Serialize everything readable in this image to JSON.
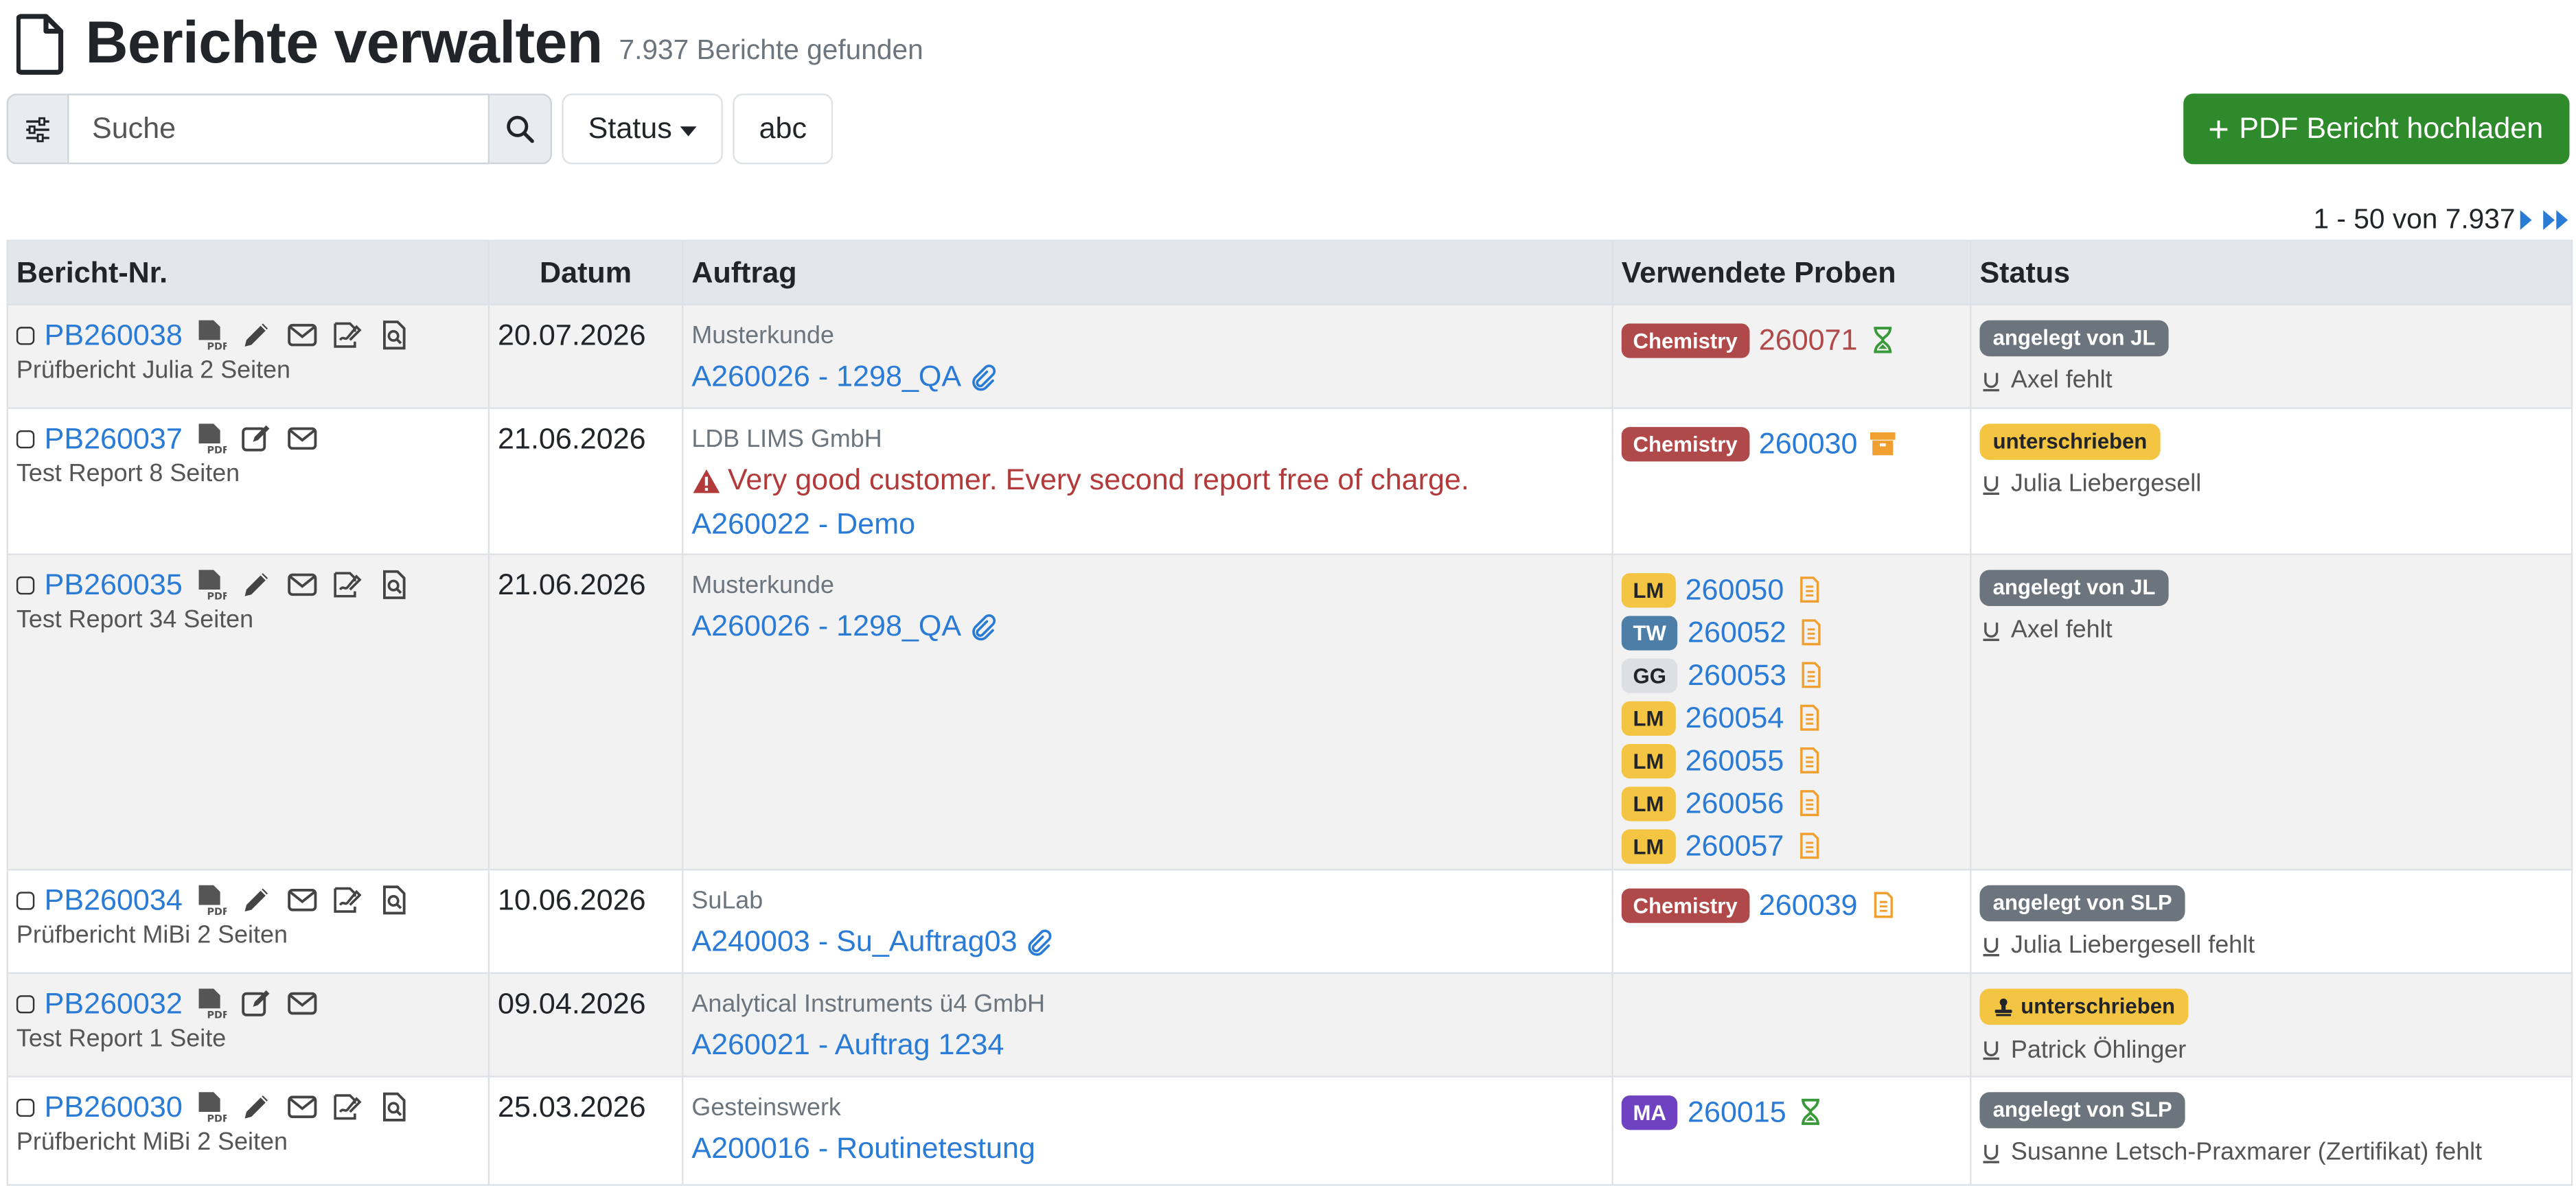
{
  "header": {
    "title": "Berichte verwalten",
    "subtitle": "7.937 Berichte gefunden"
  },
  "toolbar": {
    "search_placeholder": "Suche",
    "status_label": "Status",
    "abc_label": "abc",
    "upload_label": "PDF Bericht hochladen"
  },
  "pagination": {
    "text": "1 - 50 von 7.937"
  },
  "table": {
    "columns": [
      "Bericht-Nr.",
      "Datum",
      "Auftrag",
      "Verwendete Proben",
      "Status"
    ],
    "rows": [
      {
        "report": "PB260038",
        "desc": "Prüfbericht Julia 2 Seiten",
        "date": "20.07.2026",
        "customer": "Musterkunde",
        "order": "A260026 - 1298_QA",
        "status": "angelegt von JL",
        "signer": "Axel fehlt",
        "samples": [
          {
            "badge": "Chemistry",
            "num": "260071"
          }
        ]
      },
      {
        "report": "PB260037",
        "desc": "Test Report 8 Seiten",
        "date": "21.06.2026",
        "customer": "LDB LIMS GmbH",
        "alert": "Very good customer. Every second report free of charge.",
        "order": "A260022 - Demo",
        "status": "unterschrieben",
        "signer": "Julia Liebergesell",
        "samples": [
          {
            "badge": "Chemistry",
            "num": "260030"
          }
        ]
      },
      {
        "report": "PB260035",
        "desc": "Test Report 34 Seiten",
        "date": "21.06.2026",
        "customer": "Musterkunde",
        "order": "A260026 - 1298_QA",
        "status": "angelegt von JL",
        "signer": "Axel fehlt",
        "samples": [
          {
            "badge": "LM",
            "num": "260050"
          },
          {
            "badge": "TW",
            "num": "260052"
          },
          {
            "badge": "GG",
            "num": "260053"
          },
          {
            "badge": "LM",
            "num": "260054"
          },
          {
            "badge": "LM",
            "num": "260055"
          },
          {
            "badge": "LM",
            "num": "260056"
          },
          {
            "badge": "LM",
            "num": "260057"
          }
        ]
      },
      {
        "report": "PB260034",
        "desc": "Prüfbericht MiBi 2 Seiten",
        "date": "10.06.2026",
        "customer": "SuLab",
        "order": "A240003 - Su_Auftrag03",
        "status": "angelegt von SLP",
        "signer": "Julia Liebergesell fehlt",
        "samples": [
          {
            "badge": "Chemistry",
            "num": "260039"
          }
        ]
      },
      {
        "report": "PB260032",
        "desc": "Test Report 1 Seite",
        "date": "09.04.2026",
        "customer": "Analytical Instruments ü4 GmbH",
        "order": "A260021 - Auftrag 1234",
        "status": "unterschrieben",
        "signer": "Patrick Öhlinger"
      },
      {
        "report": "PB260030",
        "desc": "Prüfbericht MiBi 2 Seiten",
        "date": "25.03.2026",
        "customer": "Gesteinswerk",
        "order": "A200016 - Routinetestung",
        "status": "angelegt von SLP",
        "signer": "Susanne Letsch-Praxmarer (Zertifikat) fehlt",
        "samples": [
          {
            "badge": "MA",
            "num": "260015"
          }
        ]
      }
    ]
  },
  "colors": {
    "link": "#2a7bd6",
    "upload": "#2e8a2b",
    "chemistry": "#b04a4a",
    "lm": "#f4c542",
    "tw": "#4d7ea8",
    "ma": "#6f42c1"
  }
}
